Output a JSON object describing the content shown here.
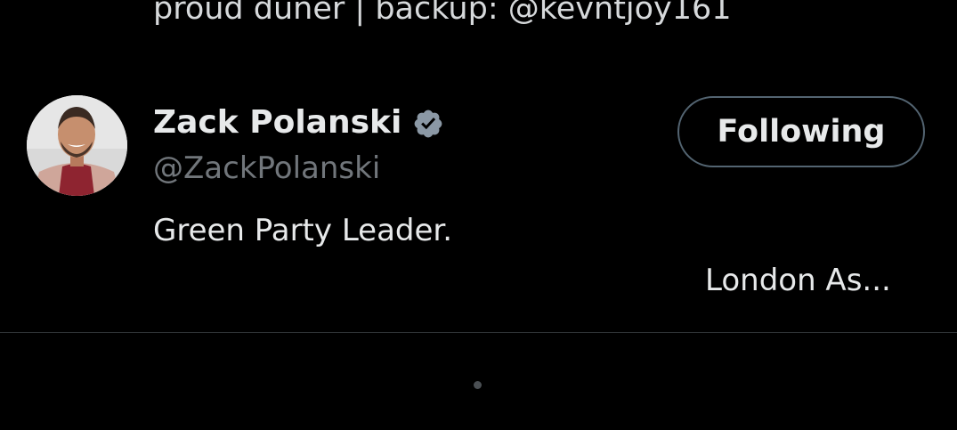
{
  "previous_user": {
    "bio": "proud duner | backup: @kevntjoy161"
  },
  "user": {
    "display_name": "Zack Polanski",
    "verified": true,
    "handle": "@ZackPolanski",
    "bio": "Green Party Leader.",
    "location": "London As...",
    "follow_button_label": "Following"
  },
  "icons": {
    "verified": "verified-badge-icon",
    "loading": "loading-dot-icon"
  },
  "colors": {
    "background": "#000000",
    "primary_text": "#e7e9ea",
    "secondary_text": "#71767b",
    "button_border": "#536471",
    "divider": "#2f3336",
    "verified_badge": "#8b98a5"
  }
}
